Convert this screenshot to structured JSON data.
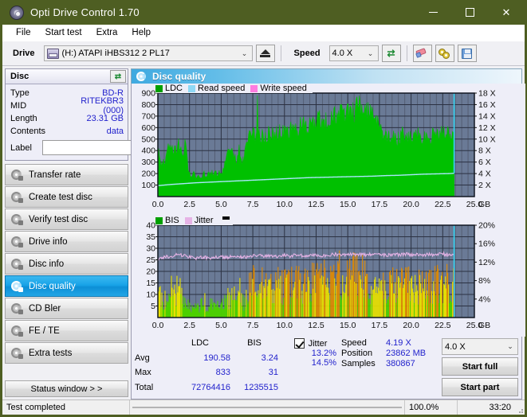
{
  "window": {
    "title": "Opti Drive Control 1.70",
    "icon": "disc-icon",
    "minimize": "—",
    "maximize": "▢",
    "close": "✕"
  },
  "menu": {
    "items": [
      "File",
      "Start test",
      "Extra",
      "Help"
    ]
  },
  "toolbar": {
    "drive_label": "Drive",
    "drive_value": "(H:)  ATAPI iHBS312  2 PL17",
    "eject_title": "Eject",
    "speed_label": "Speed",
    "speed_value": "4.0 X",
    "refresh_icon": "refresh-icon",
    "erase_icon": "eraser-icon",
    "discs_icon": "two-discs-icon",
    "save_icon": "save-icon"
  },
  "disc_panel": {
    "title": "Disc",
    "refresh_icon": "refresh-icon",
    "rows": [
      {
        "key": "Type",
        "value": "BD-R"
      },
      {
        "key": "MID",
        "value": "RITEKBR3 (000)"
      },
      {
        "key": "Length",
        "value": "23.31 GB"
      },
      {
        "key": "Contents",
        "value": "data"
      }
    ],
    "label_key": "Label",
    "label_value": "",
    "label_button_icon": "disc-icon"
  },
  "nav": {
    "items": [
      {
        "label": "Transfer rate",
        "active": false
      },
      {
        "label": "Create test disc",
        "active": false
      },
      {
        "label": "Verify test disc",
        "active": false
      },
      {
        "label": "Drive info",
        "active": false
      },
      {
        "label": "Disc info",
        "active": false
      },
      {
        "label": "Disc quality",
        "active": true
      },
      {
        "label": "CD Bler",
        "active": false
      },
      {
        "label": "FE / TE",
        "active": false
      },
      {
        "label": "Extra tests",
        "active": false
      }
    ],
    "status_window": "Status window > >"
  },
  "content_header": {
    "title": "Disc quality",
    "icon": "disc-quality-icon"
  },
  "results": {
    "col_headers": [
      "",
      "LDC",
      "BIS"
    ],
    "rows": [
      {
        "key": "Avg",
        "ldc": "190.58",
        "bis": "3.24"
      },
      {
        "key": "Max",
        "ldc": "833",
        "bis": "31"
      },
      {
        "key": "Total",
        "ldc": "72764416",
        "bis": "1235515"
      }
    ],
    "jitter_label": "Jitter",
    "jitter_checked": true,
    "jitter_avg": "13.2%",
    "jitter_max": "14.5%",
    "speed_key": "Speed",
    "speed_value": "4.19 X",
    "position_key": "Position",
    "position_value": "23862 MB",
    "samples_key": "Samples",
    "samples_value": "380867",
    "speed_select": "4.0 X",
    "start_full": "Start full",
    "start_part": "Start part"
  },
  "statusbar": {
    "message": "Test completed",
    "progress_percent": "100.0%",
    "progress_value": 100,
    "elapsed": "33:20"
  },
  "colors": {
    "titlebar": "#4e5e22",
    "accent_blue": "#18a3e8",
    "value_text": "#2222cc",
    "ldc_green": "#00c000",
    "read_speed": "#8fd8f5",
    "write_speed": "#ff7ce0",
    "jitter_pink": "#e6b3e6",
    "plot_bg": "#6a7a96",
    "progress_green": "#0aa116"
  },
  "chart_data": [
    {
      "type": "area",
      "id": "ldc-chart",
      "title": "",
      "legend": [
        {
          "label": "LDC",
          "color": "#00a000"
        },
        {
          "label": "Read speed",
          "color": "#8fd8f5"
        },
        {
          "label": "Write speed",
          "color": "#ff7ce0"
        }
      ],
      "legend_position": "top-left",
      "xlabel": "GB",
      "x_ticks": [
        "0.0",
        "2.5",
        "5.0",
        "7.5",
        "10.0",
        "12.5",
        "15.0",
        "17.5",
        "20.0",
        "22.5",
        "25.0"
      ],
      "xlim": [
        0,
        25
      ],
      "ylabel_left": "LDC",
      "y_ticks_left": [
        "100",
        "200",
        "300",
        "400",
        "500",
        "600",
        "700",
        "800",
        "900"
      ],
      "ylim_left": [
        0,
        900
      ],
      "ylabel_right": "Speed",
      "y_ticks_right": [
        "2 X",
        "4 X",
        "6 X",
        "8 X",
        "10 X",
        "12 X",
        "14 X",
        "16 X",
        "18 X"
      ],
      "ylim_right": [
        0,
        18
      ],
      "grid": true,
      "data_end_x": 23.4,
      "series": [
        {
          "name": "LDC",
          "color": "#00c000",
          "x": [
            0.0,
            0.15,
            0.3,
            0.45,
            0.6,
            0.8,
            1.0,
            1.2,
            1.4,
            1.6,
            1.8,
            2.0,
            2.2,
            2.4,
            2.5,
            2.6,
            2.8,
            3.0,
            3.2,
            3.4,
            3.6,
            3.8,
            4.0,
            4.2,
            4.4,
            4.6,
            4.8,
            5.0,
            5.2,
            5.4,
            5.6,
            5.8,
            6.0,
            6.2,
            6.4,
            6.6,
            6.8,
            7.0,
            7.2,
            7.4,
            7.6,
            7.8,
            8.0,
            8.4,
            8.8,
            9.2,
            9.6,
            10.0,
            10.4,
            10.8,
            11.2,
            11.6,
            12.0,
            12.4,
            12.8,
            13.2,
            13.6,
            14.0,
            14.4,
            14.8,
            15.2,
            15.6,
            16.0,
            16.4,
            16.8,
            17.2,
            17.5,
            17.8,
            18.2,
            18.6,
            19.0,
            19.4,
            19.8,
            20.2,
            20.6,
            21.0,
            21.4,
            21.8,
            22.2,
            22.6,
            23.0,
            23.4
          ],
          "y": [
            465,
            300,
            260,
            320,
            280,
            430,
            395,
            400,
            380,
            450,
            390,
            340,
            505,
            205,
            195,
            175,
            200,
            165,
            185,
            175,
            200,
            175,
            195,
            190,
            215,
            200,
            200,
            205,
            245,
            300,
            385,
            400,
            370,
            280,
            405,
            300,
            300,
            470,
            555,
            520,
            530,
            520,
            540,
            530,
            545,
            535,
            545,
            540,
            555,
            575,
            590,
            620,
            600,
            630,
            655,
            640,
            650,
            700,
            690,
            720,
            680,
            740,
            760,
            700,
            720,
            680,
            620,
            500,
            505,
            520,
            510,
            530,
            500,
            505,
            520,
            505,
            515,
            520,
            530,
            540,
            520,
            510
          ]
        },
        {
          "name": "Read speed",
          "color": "#9fe0f8",
          "x": [
            0.0,
            1.0,
            2.0,
            3.0,
            4.0,
            5.0,
            6.0,
            7.0,
            8.0,
            9.0,
            10.0,
            11.0,
            12.0,
            13.0,
            14.0,
            15.0,
            16.0,
            17.0,
            18.0,
            19.0,
            20.0,
            21.0,
            22.0,
            23.0,
            23.4
          ],
          "y": [
            1.9,
            2.1,
            2.25,
            2.4,
            2.5,
            2.6,
            2.7,
            2.8,
            2.9,
            3.0,
            3.1,
            3.2,
            3.3,
            3.35,
            3.4,
            3.45,
            3.5,
            3.55,
            3.65,
            3.7,
            3.8,
            3.9,
            3.95,
            4.0,
            4.05
          ]
        }
      ]
    },
    {
      "type": "area",
      "id": "bis-jitter-chart",
      "title": "",
      "legend": [
        {
          "label": "BIS",
          "color": "#00a000"
        },
        {
          "label": "Jitter",
          "color": "#e6b3e6"
        }
      ],
      "legend_position": "top-left",
      "xlabel": "GB",
      "x_ticks": [
        "0.0",
        "2.5",
        "5.0",
        "7.5",
        "10.0",
        "12.5",
        "15.0",
        "17.5",
        "20.0",
        "22.5",
        "25.0"
      ],
      "xlim": [
        0,
        25
      ],
      "ylabel_left": "BIS",
      "y_ticks_left": [
        "5",
        "10",
        "15",
        "20",
        "25",
        "30",
        "35",
        "40"
      ],
      "ylim_left": [
        0,
        40
      ],
      "ylabel_right": "Jitter",
      "y_ticks_right": [
        "4%",
        "8%",
        "12%",
        "16%",
        "20%"
      ],
      "ylim_right": [
        0,
        20
      ],
      "grid": true,
      "data_end_x": 23.4,
      "series": [
        {
          "name": "BIS",
          "color_low": "#4cd000",
          "color_mid": "#e8e000",
          "color_high": "#e08a00",
          "x": [
            0.0,
            0.3,
            0.6,
            0.9,
            1.2,
            1.5,
            1.8,
            2.1,
            2.4,
            2.7,
            3.0,
            3.3,
            3.6,
            3.9,
            4.2,
            4.5,
            4.8,
            5.1,
            5.4,
            5.7,
            6.0,
            6.3,
            6.6,
            6.9,
            7.2,
            7.5,
            7.8,
            8.1,
            8.4,
            8.7,
            9.0,
            9.3,
            9.6,
            9.9,
            10.2,
            10.5,
            10.8,
            11.1,
            11.4,
            11.7,
            12.0,
            12.3,
            12.6,
            12.9,
            13.2,
            13.5,
            13.8,
            14.1,
            14.4,
            14.7,
            15.0,
            15.3,
            15.6,
            15.9,
            16.2,
            16.5,
            16.8,
            17.1,
            17.4,
            17.7,
            18.0,
            18.3,
            18.6,
            18.9,
            19.2,
            19.5,
            19.8,
            20.1,
            20.4,
            20.7,
            21.0,
            21.3,
            21.6,
            21.9,
            22.2,
            22.5,
            22.8,
            23.1,
            23.4
          ],
          "y": [
            14,
            11,
            10,
            13,
            16,
            15,
            14,
            10,
            7,
            7,
            6,
            7,
            7,
            6,
            7,
            7,
            6,
            8,
            9,
            12,
            13,
            11,
            9,
            10,
            17,
            20,
            15,
            19,
            18,
            17,
            16,
            18,
            19,
            17,
            21,
            18,
            20,
            19,
            18,
            21,
            20,
            22,
            19,
            21,
            23,
            20,
            22,
            21,
            26,
            23,
            25,
            22,
            24,
            21,
            23,
            20,
            19,
            18,
            17,
            19,
            18,
            17,
            19,
            18,
            17,
            19,
            18,
            17,
            18,
            19,
            17,
            18,
            17,
            19,
            18,
            17,
            19,
            18,
            17
          ]
        },
        {
          "name": "Jitter",
          "color": "#e6b3e6",
          "x": [
            0.0,
            0.5,
            1.0,
            1.5,
            2.0,
            2.5,
            3.0,
            3.5,
            4.0,
            4.5,
            5.0,
            5.5,
            6.0,
            6.5,
            7.0,
            7.5,
            8.0,
            8.5,
            9.0,
            9.5,
            10.0,
            10.5,
            11.0,
            11.5,
            12.0,
            12.5,
            13.0,
            13.5,
            14.0,
            14.5,
            15.0,
            15.5,
            16.0,
            16.5,
            17.0,
            17.5,
            18.0,
            18.5,
            19.0,
            19.5,
            20.0,
            20.5,
            21.0,
            21.5,
            22.0,
            22.5,
            23.0,
            23.4
          ],
          "y": [
            12.7,
            13.1,
            13.3,
            13.6,
            13.4,
            13.2,
            12.9,
            13.1,
            12.9,
            13.0,
            13.2,
            13.0,
            13.3,
            13.2,
            13.0,
            13.3,
            13.4,
            13.2,
            13.4,
            13.3,
            13.5,
            13.3,
            13.6,
            13.4,
            13.5,
            13.6,
            13.4,
            13.6,
            13.7,
            13.5,
            13.8,
            13.6,
            13.7,
            13.5,
            13.8,
            13.6,
            13.5,
            13.7,
            13.6,
            13.8,
            13.6,
            13.7,
            13.5,
            13.7,
            13.6,
            13.8,
            13.6,
            13.7
          ]
        }
      ]
    }
  ]
}
